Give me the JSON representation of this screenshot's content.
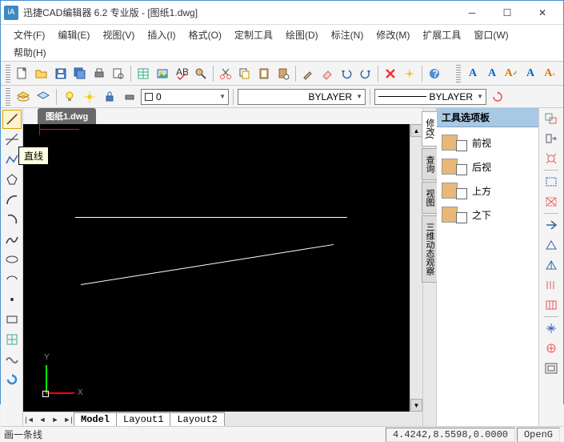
{
  "title": "迅捷CAD编辑器 6.2 专业版  -  [图纸1.dwg]",
  "menus": {
    "file": "文件(F)",
    "edit": "编辑(E)",
    "view": "视图(V)",
    "insert": "插入(I)",
    "format": "格式(O)",
    "custom": "定制工具",
    "draw": "绘图(D)",
    "dim": "标注(N)",
    "modify": "修改(M)",
    "ext": "扩展工具",
    "window": "窗口(W)",
    "help": "帮助(H)"
  },
  "doc_tab": "图纸1.dwg",
  "bylayer1": "BYLAYER",
  "bylayer2": "BYLAYER",
  "layer_dropdown": "0",
  "tooltip": "直线",
  "layout": {
    "model": "Model",
    "l1": "Layout1",
    "l2": "Layout2"
  },
  "panel_title": "工具选项板",
  "views": {
    "front": "前视",
    "back": "后视",
    "top": "上方",
    "bottom": "之下"
  },
  "vtabs": {
    "modify": "修改(",
    "query": "查询",
    "view": "视图",
    "orbit": "三维动态观察"
  },
  "axis": {
    "x": "X",
    "y": "Y"
  },
  "status": {
    "hint": "画一条线",
    "coords": "4.4242,8.5598,0.0000",
    "render": "OpenG"
  }
}
